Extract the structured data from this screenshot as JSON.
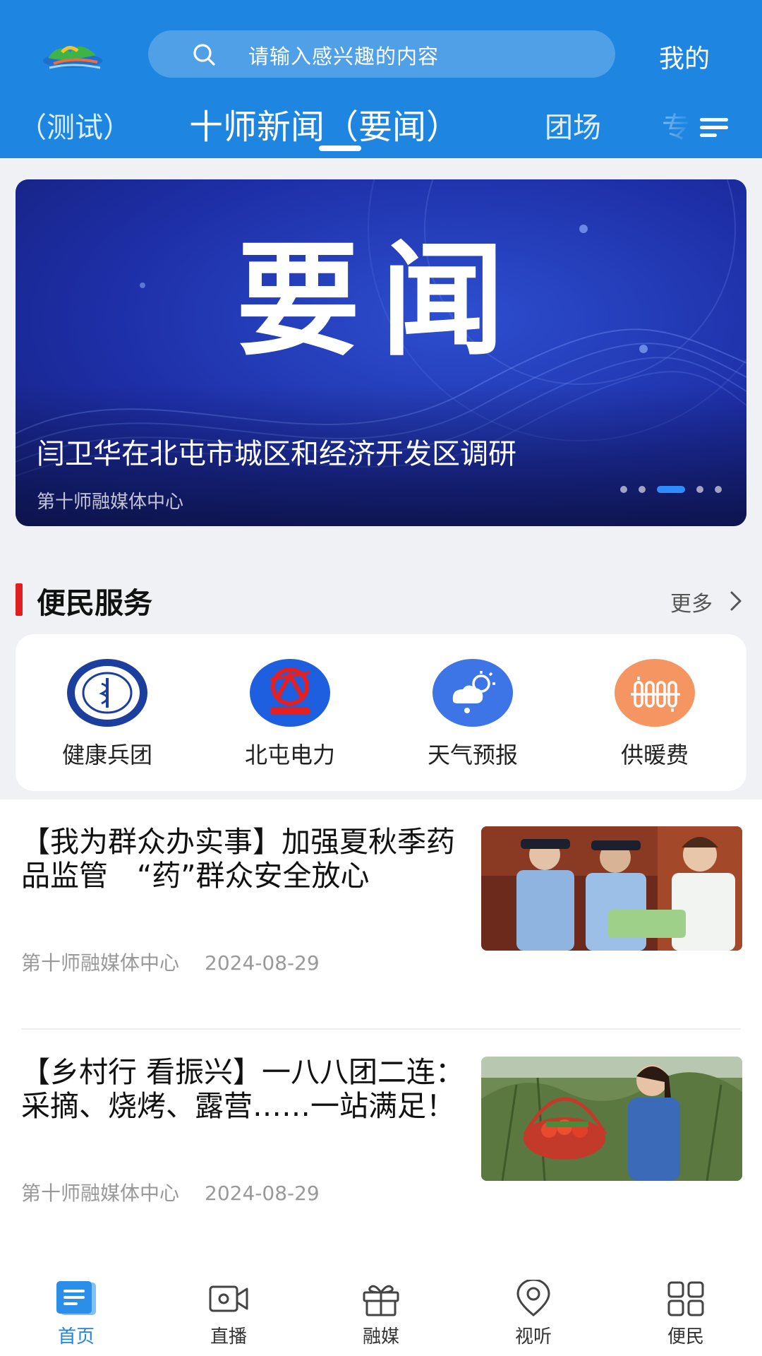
{
  "header": {
    "search_placeholder": "请输入感兴趣的内容",
    "mine_label": "我的",
    "tabs": [
      {
        "label": "（测试）"
      },
      {
        "label": "十师新闻（要闻）"
      },
      {
        "label": "团场"
      },
      {
        "label": "专"
      }
    ],
    "active_tab_index": 1,
    "colors": {
      "header_bg": "#1e86e0"
    }
  },
  "banner": {
    "image_text": "要闻",
    "title": "闫卫华在北屯市城区和经济开发区调研",
    "source": "第十师融媒体中心",
    "page_count": 5,
    "active_page_index": 2
  },
  "services_section": {
    "title": "便民服务",
    "more_label": "更多",
    "items": [
      {
        "label": "健康兵团",
        "icon": "health-corps-emblem-icon"
      },
      {
        "label": "北屯电力",
        "icon": "beitun-power-logo-icon"
      },
      {
        "label": "天气预报",
        "icon": "weather-icon"
      },
      {
        "label": "供暖费",
        "icon": "heating-radiator-icon"
      }
    ]
  },
  "news": [
    {
      "title": "【我为群众办实事】加强夏秋季药品监管　“药”群众安全放心",
      "source": "第十师融媒体中心",
      "date": "2024-08-29",
      "thumb": "officers-inspecting-medicine-photo"
    },
    {
      "title": "【乡村行 看振兴】一八八团二连：采摘、烧烤、露营……一站满足！",
      "source": "第十师融媒体中心",
      "date": "2024-08-29",
      "thumb": "woman-picking-vegetables-photo"
    }
  ],
  "bottom_nav": [
    {
      "label": "首页",
      "icon": "home-icon",
      "active": true
    },
    {
      "label": "直播",
      "icon": "video-camera-icon",
      "active": false
    },
    {
      "label": "融媒",
      "icon": "gift-box-icon",
      "active": false
    },
    {
      "label": "视听",
      "icon": "location-pin-icon",
      "active": false
    },
    {
      "label": "便民",
      "icon": "grid-apps-icon",
      "active": false
    }
  ],
  "colors": {
    "accent": "#1e86e0",
    "section_bar": "#e02020"
  }
}
